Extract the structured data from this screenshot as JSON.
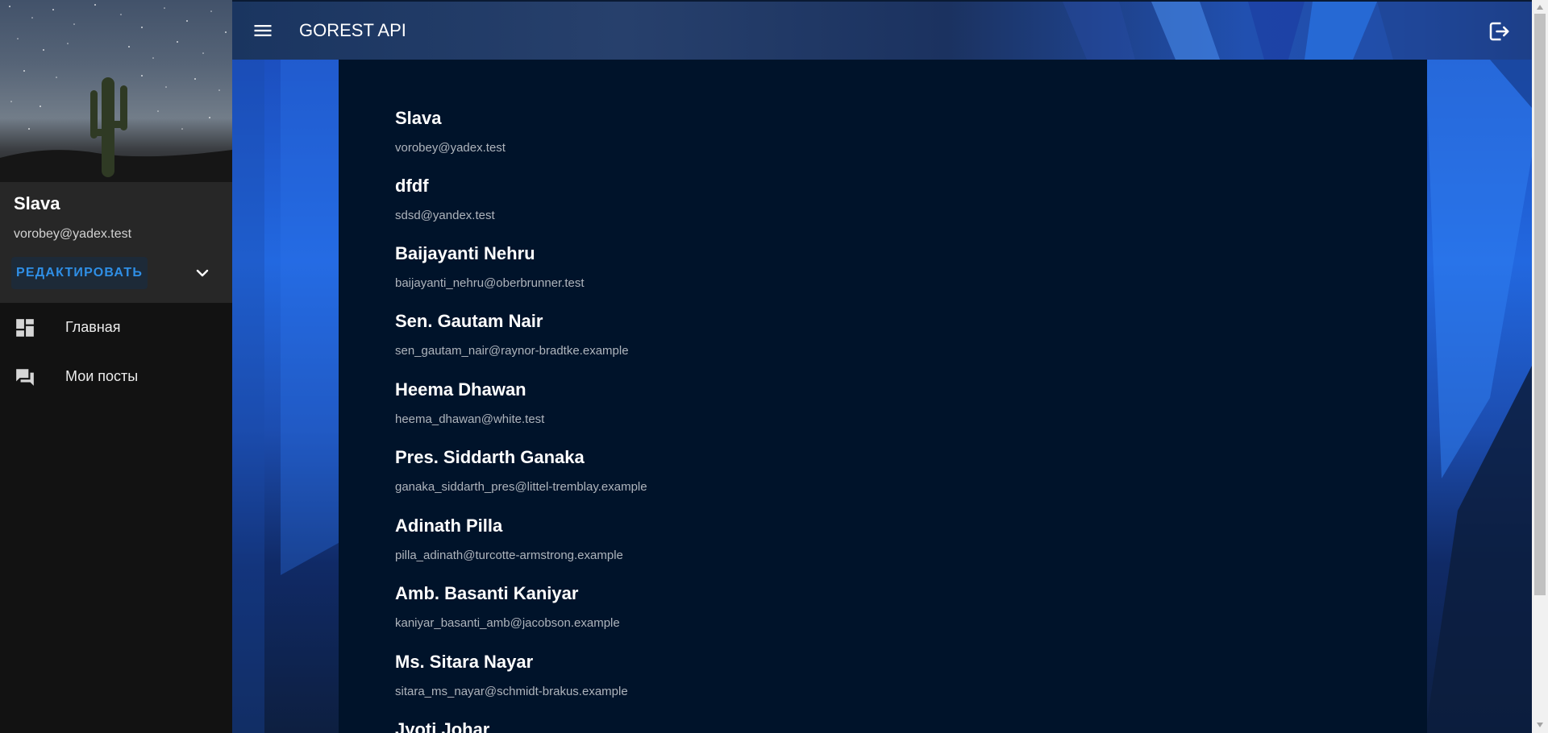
{
  "app": {
    "title": "GOREST API"
  },
  "sidebar": {
    "user": {
      "name": "Slava",
      "email": "vorobey@yadex.test"
    },
    "edit_label": "РЕДАКТИРОВАТЬ",
    "nav": [
      {
        "label": "Главная",
        "icon": "dashboard-icon"
      },
      {
        "label": "Мои посты",
        "icon": "forum-icon"
      }
    ]
  },
  "users": [
    {
      "name": "Slava",
      "email": "vorobey@yadex.test"
    },
    {
      "name": "dfdf",
      "email": "sdsd@yandex.test"
    },
    {
      "name": "Baijayanti Nehru",
      "email": "baijayanti_nehru@oberbrunner.test"
    },
    {
      "name": "Sen. Gautam Nair",
      "email": "sen_gautam_nair@raynor-bradtke.example"
    },
    {
      "name": "Heema Dhawan",
      "email": "heema_dhawan@white.test"
    },
    {
      "name": "Pres. Siddarth Ganaka",
      "email": "ganaka_siddarth_pres@littel-tremblay.example"
    },
    {
      "name": "Adinath Pilla",
      "email": "pilla_adinath@turcotte-armstrong.example"
    },
    {
      "name": "Amb. Basanti Kaniyar",
      "email": "kaniyar_basanti_amb@jacobson.example"
    },
    {
      "name": "Ms. Sitara Nayar",
      "email": "sitara_ms_nayar@schmidt-brakus.example"
    },
    {
      "name": "Jyoti Johar",
      "email": ""
    }
  ],
  "colors": {
    "accent": "#2f8fe6",
    "card_bg": "#00132a",
    "sidebar_bg": "#121212"
  }
}
